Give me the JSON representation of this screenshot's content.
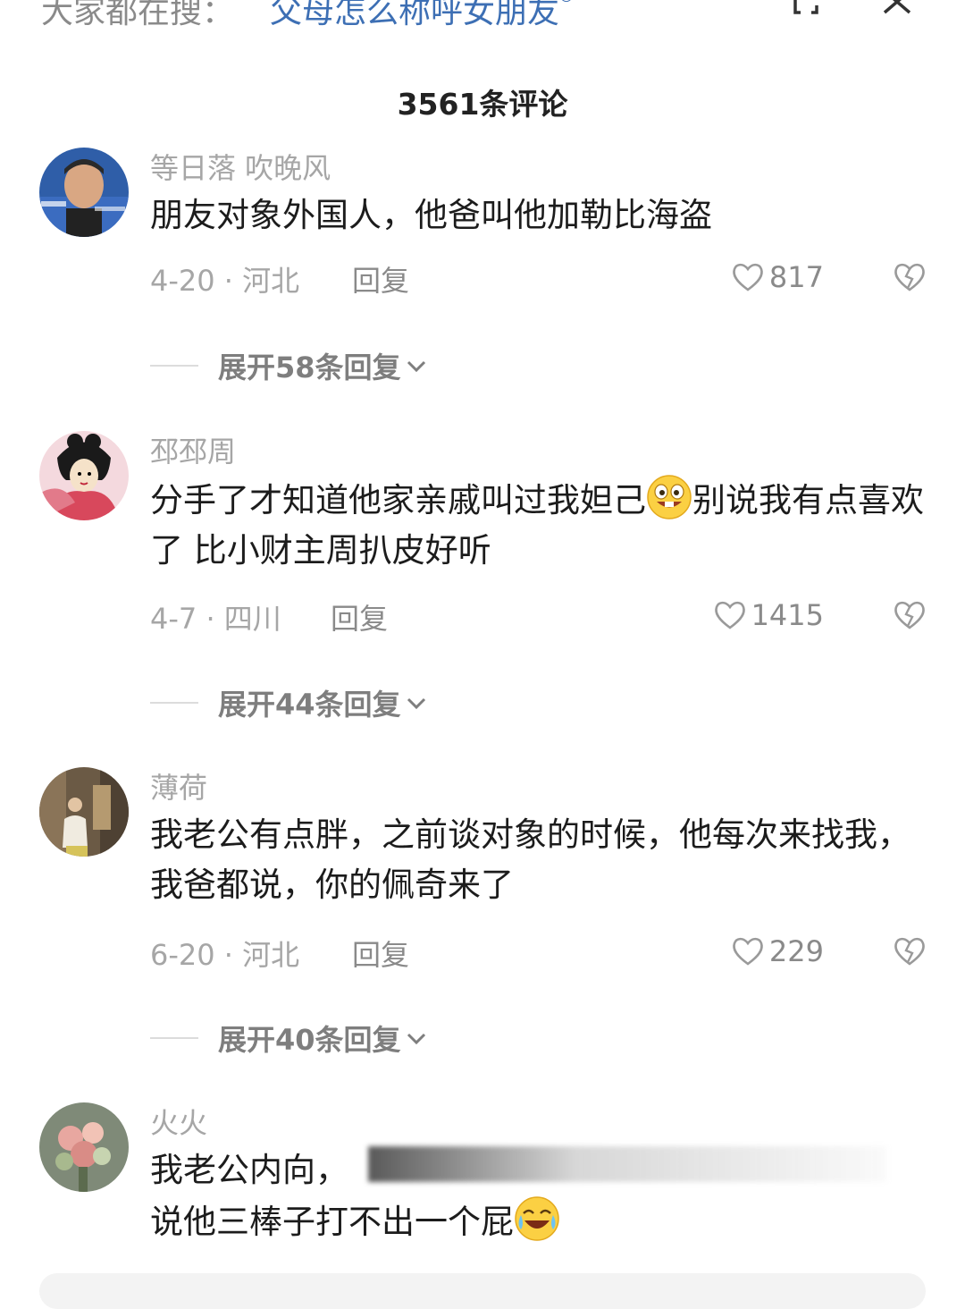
{
  "search": {
    "prefix": "大家都在搜：",
    "query": "父母怎么称呼女朋友",
    "query_icon": "search-icon"
  },
  "header": {
    "comment_count": "3561条评论"
  },
  "comments": [
    {
      "username": "等日落 吹晚风",
      "text": "朋友对象外国人，他爸叫他加勒比海盗",
      "date": "4-20 · 河北",
      "reply": "回复",
      "likes": "817",
      "expand": "展开58条回复"
    },
    {
      "username": "邳邳周",
      "text_before_emoji": "分手了才知道他家亲戚叫过我妲己",
      "emoji": "grinning-buck-teeth-emoji",
      "text_after_emoji": "别说我有点喜欢了 比小财主周扒皮好听",
      "date": "4-7 · 四川",
      "reply": "回复",
      "likes": "1415",
      "expand": "展开44条回复"
    },
    {
      "username": "薄荷",
      "text": "我老公有点胖，之前谈对象的时候，他每次来找我，我爸都说，你的佩奇来了",
      "date": "6-20 · 河北",
      "reply": "回复",
      "likes": "229",
      "expand": "展开40条回复"
    },
    {
      "username": "火火",
      "text_line1": "我老公内向，",
      "text_line2": "说他三棒子打不出一个屁",
      "emoji": "laughing-crying-emoji"
    }
  ],
  "colors": {
    "link": "#3d6fb4",
    "muted": "#a6a6a6",
    "text": "#1c1c1c"
  }
}
